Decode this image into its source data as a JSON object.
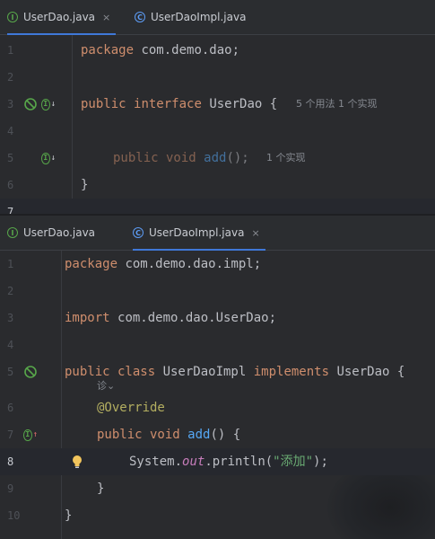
{
  "top_pane": {
    "tabs": [
      {
        "label": "UserDao.java",
        "icon": "interface-icon",
        "active": true
      },
      {
        "label": "UserDaoImpl.java",
        "icon": "class-icon",
        "active": false
      }
    ],
    "close_glyph": "×",
    "lines": [
      {
        "n": "1",
        "tokens": [
          {
            "t": "package ",
            "c": ""
          },
          {
            "t": "com.demo.dao;",
            "c": ""
          }
        ]
      },
      {
        "n": "2",
        "tokens": []
      },
      {
        "n": "3",
        "tokens": [
          {
            "t": "public ",
            "c": "kw"
          },
          {
            "t": "interface ",
            "c": "kw"
          },
          {
            "t": "UserDao { ",
            "c": ""
          }
        ],
        "hint": "5 个用法   1 个实现"
      },
      {
        "n": "4",
        "tokens": []
      },
      {
        "n": "5",
        "tokens": [
          {
            "t": "public void ",
            "c": "kw"
          },
          {
            "t": "add",
            "c": "fn"
          },
          {
            "t": "();",
            "c": ""
          }
        ],
        "hint": "1 个实现"
      },
      {
        "n": "6",
        "tokens": [
          {
            "t": "}",
            "c": ""
          }
        ]
      },
      {
        "n": "7",
        "tokens": []
      }
    ]
  },
  "bottom_pane": {
    "tabs": [
      {
        "label": "UserDao.java",
        "icon": "interface-icon",
        "active": false
      },
      {
        "label": "UserDaoImpl.java",
        "icon": "class-icon",
        "active": true
      }
    ],
    "close_glyph": "×",
    "author_hint": "诊⌄",
    "lines": [
      {
        "n": "1",
        "tokens": [
          {
            "t": "package ",
            "c": "kw"
          },
          {
            "t": "com.demo.dao.impl;",
            "c": ""
          }
        ]
      },
      {
        "n": "2",
        "tokens": []
      },
      {
        "n": "3",
        "tokens": [
          {
            "t": "import ",
            "c": "kw"
          },
          {
            "t": "com.demo.dao.UserDao;",
            "c": ""
          }
        ]
      },
      {
        "n": "4",
        "tokens": []
      },
      {
        "n": "5",
        "tokens": [
          {
            "t": "public class ",
            "c": "kw"
          },
          {
            "t": "UserDaoImpl ",
            "c": ""
          },
          {
            "t": "implements ",
            "c": "kw"
          },
          {
            "t": "UserDao {",
            "c": ""
          }
        ]
      },
      {
        "n": "6",
        "tokens": [
          {
            "t": "@Override",
            "c": "ann"
          }
        ]
      },
      {
        "n": "7",
        "tokens": [
          {
            "t": "public void ",
            "c": "kw"
          },
          {
            "t": "add",
            "c": "fn"
          },
          {
            "t": "() {",
            "c": ""
          }
        ]
      },
      {
        "n": "8",
        "tokens": [
          {
            "t": "System.",
            "c": ""
          },
          {
            "t": "out",
            "c": "fld"
          },
          {
            "t": ".println(",
            "c": ""
          },
          {
            "t": "\"添加\"",
            "c": "str"
          },
          {
            "t": ");",
            "c": ""
          }
        ]
      },
      {
        "n": "9",
        "tokens": [
          {
            "t": "}",
            "c": ""
          }
        ]
      },
      {
        "n": "10",
        "tokens": [
          {
            "t": "}",
            "c": ""
          }
        ]
      }
    ]
  }
}
